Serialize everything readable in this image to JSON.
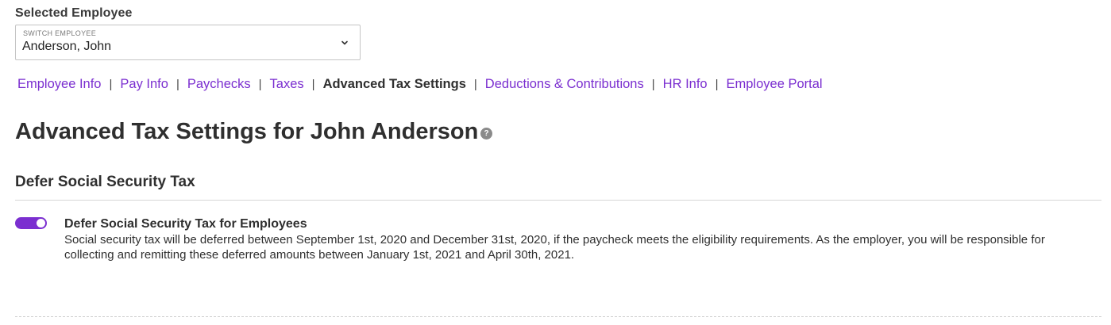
{
  "employee_selector": {
    "heading": "Selected Employee",
    "caption": "SWITCH EMPLOYEE",
    "value": "Anderson, John"
  },
  "nav": {
    "items": [
      {
        "label": "Employee Info",
        "active": false
      },
      {
        "label": "Pay Info",
        "active": false
      },
      {
        "label": "Paychecks",
        "active": false
      },
      {
        "label": "Taxes",
        "active": false
      },
      {
        "label": "Advanced Tax Settings",
        "active": true
      },
      {
        "label": "Deductions & Contributions",
        "active": false
      },
      {
        "label": "HR Info",
        "active": false
      },
      {
        "label": "Employee Portal",
        "active": false
      }
    ],
    "separator": "|"
  },
  "page": {
    "title": "Advanced Tax Settings for John Anderson",
    "help_icon_glyph": "?"
  },
  "section": {
    "title": "Defer Social Security Tax",
    "setting": {
      "title": "Defer Social Security Tax for Employees",
      "description": "Social security tax will be deferred between September 1st, 2020 and December 31st, 2020, if the paycheck meets the eligibility requirements. As the employer, you will be responsible for collecting and remitting these deferred amounts between January 1st, 2021 and April 30th, 2021.",
      "enabled": true
    }
  },
  "colors": {
    "accent": "#7b2fd0",
    "text": "#2f2f2f"
  }
}
